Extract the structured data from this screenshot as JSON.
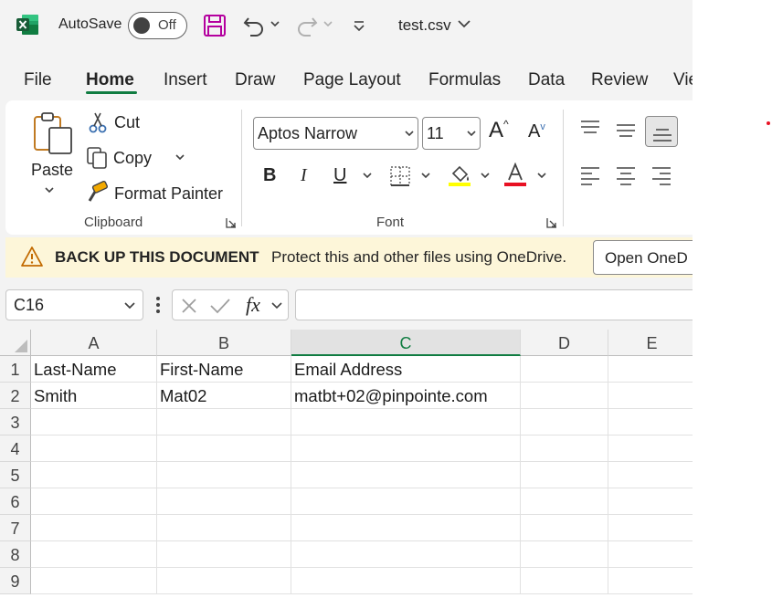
{
  "title_bar": {
    "autosave_label": "AutoSave",
    "autosave_state": "Off",
    "document_title": "test.csv"
  },
  "menu": {
    "tabs": [
      {
        "label": "File"
      },
      {
        "label": "Home",
        "active": true
      },
      {
        "label": "Insert"
      },
      {
        "label": "Draw"
      },
      {
        "label": "Page Layout"
      },
      {
        "label": "Formulas"
      },
      {
        "label": "Data"
      },
      {
        "label": "Review"
      },
      {
        "label": "Vie"
      }
    ]
  },
  "ribbon": {
    "clipboard": {
      "paste_label": "Paste",
      "cut_label": "Cut",
      "copy_label": "Copy",
      "format_painter_label": "Format Painter",
      "group_label": "Clipboard"
    },
    "font": {
      "font_name": "Aptos Narrow",
      "font_size": "11",
      "group_label": "Font",
      "highlight_color": "#ffff00",
      "font_color": "#e81123"
    }
  },
  "backup_bar": {
    "title": "BACK UP THIS DOCUMENT",
    "message": "Protect this and other files using OneDrive.",
    "button_label": "Open OneD"
  },
  "formula_bar": {
    "name_box": "C16",
    "formula": ""
  },
  "sheet": {
    "columns": [
      "A",
      "B",
      "C",
      "D",
      "E"
    ],
    "selected_column": "C",
    "row_numbers": [
      "1",
      "2",
      "3",
      "4",
      "5",
      "6",
      "7",
      "8",
      "9"
    ],
    "rows": [
      [
        "Last-Name",
        "First-Name",
        "Email Address",
        "",
        ""
      ],
      [
        "Smith",
        "Mat02",
        "matbt+02@pinpointe.com",
        "",
        ""
      ]
    ]
  },
  "colors": {
    "accent": "#107c41",
    "save_icon": "#b4009e"
  }
}
